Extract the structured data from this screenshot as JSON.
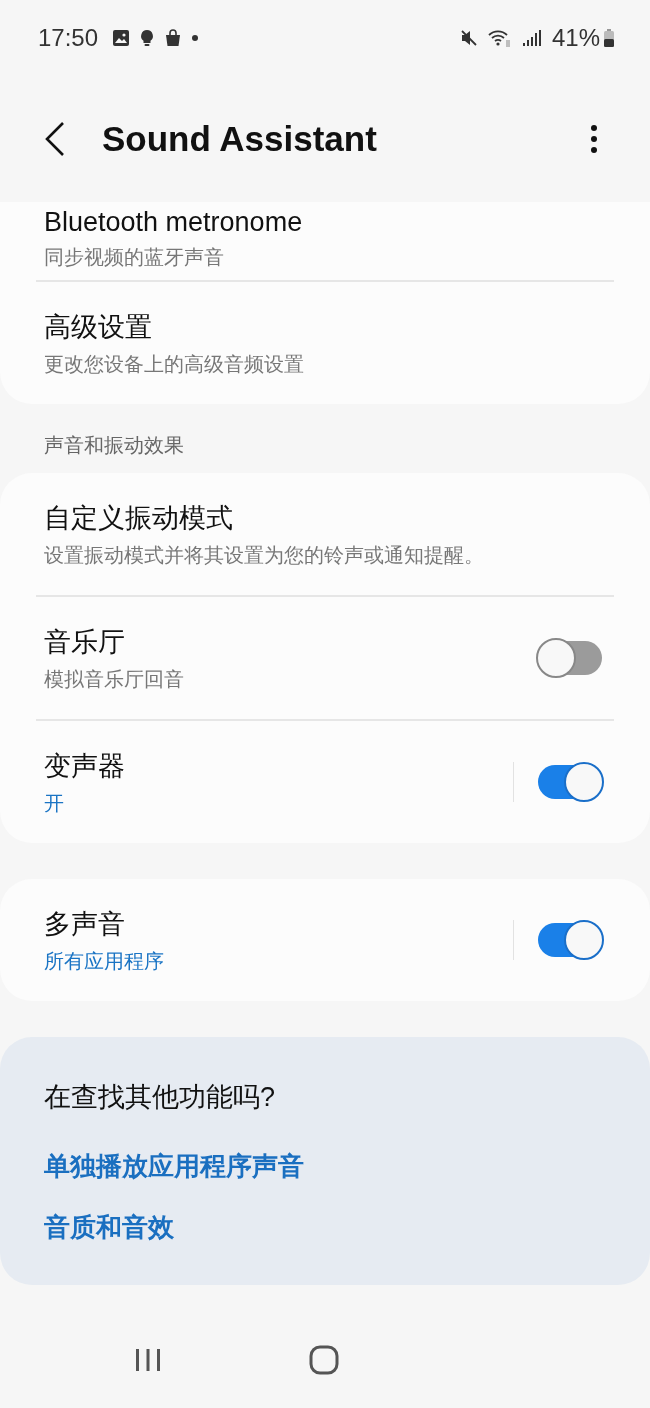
{
  "status_bar": {
    "time": "17:50",
    "battery": "41%"
  },
  "header": {
    "title": "Sound Assistant"
  },
  "groups": [
    {
      "items": [
        {
          "kind": "link",
          "title": "Bluetooth metronome",
          "subtitle": "同步视频的蓝牙声音"
        },
        {
          "kind": "link",
          "title": "高级设置",
          "subtitle": "更改您设备上的高级音频设置"
        }
      ]
    },
    {
      "heading": "声音和振动效果",
      "items": [
        {
          "kind": "link",
          "title": "自定义振动模式",
          "subtitle": "设置振动模式并将其设置为您的铃声或通知提醒。"
        },
        {
          "kind": "toggle",
          "title": "音乐厅",
          "subtitle": "模拟音乐厅回音",
          "on": false
        },
        {
          "kind": "split-toggle",
          "title": "变声器",
          "subtitle": "开",
          "on": true
        }
      ]
    },
    {
      "items": [
        {
          "kind": "split-toggle",
          "title": "多声音",
          "subtitle": "所有应用程序",
          "on": true
        }
      ]
    }
  ],
  "suggestions": {
    "title": "在查找其他功能吗?",
    "links": [
      "单独播放应用程序声音",
      "音质和音效"
    ]
  }
}
